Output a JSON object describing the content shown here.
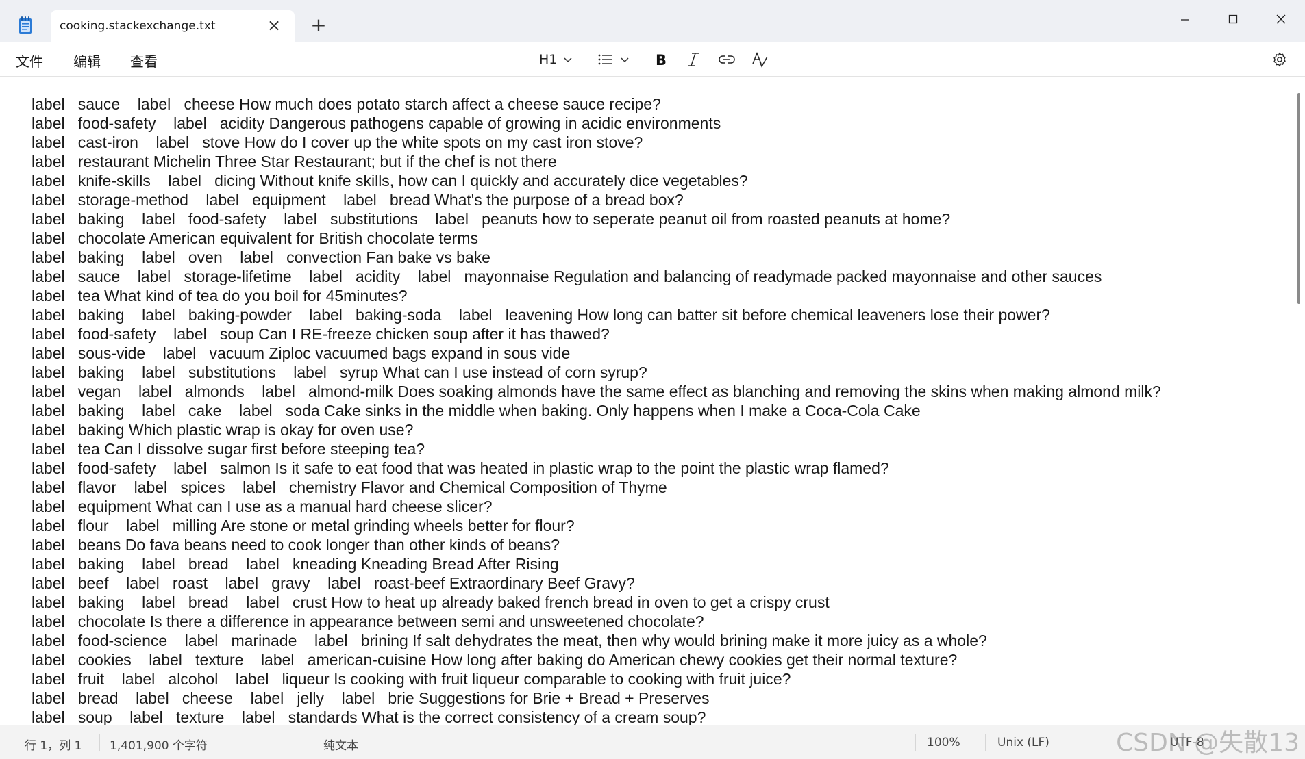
{
  "window": {
    "tab_title": "cooking.stackexchange.txt",
    "new_tab_symbol": "+",
    "close_tab_symbol": "×"
  },
  "menu": {
    "file": "文件",
    "edit": "编辑",
    "view": "查看"
  },
  "toolbar": {
    "heading": "H1"
  },
  "lines": [
    "label   sauce    label   cheese How much does potato starch affect a cheese sauce recipe?",
    "label   food-safety    label   acidity Dangerous pathogens capable of growing in acidic environments",
    "label   cast-iron    label   stove How do I cover up the white spots on my cast iron stove?",
    "label   restaurant Michelin Three Star Restaurant; but if the chef is not there",
    "label   knife-skills    label   dicing Without knife skills, how can I quickly and accurately dice vegetables?",
    "label   storage-method    label   equipment    label   bread What's the purpose of a bread box?",
    "label   baking    label   food-safety    label   substitutions    label   peanuts how to seperate peanut oil from roasted peanuts at home?",
    "label   chocolate American equivalent for British chocolate terms",
    "label   baking    label   oven    label   convection Fan bake vs bake",
    "label   sauce    label   storage-lifetime    label   acidity    label   mayonnaise Regulation and balancing of readymade packed mayonnaise and other sauces",
    "label   tea What kind of tea do you boil for 45minutes?",
    "label   baking    label   baking-powder    label   baking-soda    label   leavening How long can batter sit before chemical leaveners lose their power?",
    "label   food-safety    label   soup Can I RE-freeze chicken soup after it has thawed?",
    "label   sous-vide    label   vacuum Ziploc vacuumed bags expand in sous vide",
    "label   baking    label   substitutions    label   syrup What can I use instead of corn syrup?",
    "label   vegan    label   almonds    label   almond-milk Does soaking almonds have the same effect as blanching and removing the skins when making almond milk?",
    "label   baking    label   cake    label   soda Cake sinks in the middle when baking. Only happens when I make a Coca-Cola Cake",
    "label   baking Which plastic wrap is okay for oven use?",
    "label   tea Can I dissolve sugar first before steeping tea?",
    "label   food-safety    label   salmon Is it safe to eat food that was heated in plastic wrap to the point the plastic wrap flamed?",
    "label   flavor    label   spices    label   chemistry Flavor and Chemical Composition of Thyme",
    "label   equipment What can I use as a manual hard cheese slicer?",
    "label   flour    label   milling Are stone or metal grinding wheels better for flour?",
    "label   beans Do fava beans need to cook longer than other kinds of beans?",
    "label   baking    label   bread    label   kneading Kneading Bread After Rising",
    "label   beef    label   roast    label   gravy    label   roast-beef Extraordinary Beef Gravy?",
    "label   baking    label   bread    label   crust How to heat up already baked french bread in oven to get a crispy crust",
    "label   chocolate Is there a difference in appearance between semi and unsweetened chocolate?",
    "label   food-science    label   marinade    label   brining If salt dehydrates the meat, then why would brining make it more juicy as a whole?",
    "label   cookies    label   texture    label   american-cuisine How long after baking do American chewy cookies get their normal texture?",
    "label   fruit    label   alcohol    label   liqueur Is cooking with fruit liqueur comparable to cooking with fruit juice?",
    "label   bread    label   cheese    label   jelly    label   brie Suggestions for Brie + Bread + Preserves",
    "label   soup    label   texture    label   standards What is the correct consistency of a cream soup?"
  ],
  "status": {
    "position": "行 1，列 1",
    "char_count": "1,401,900 个字符",
    "format": "纯文本",
    "zoom": "100%",
    "line_ending": "Unix (LF)",
    "encoding": "UTF-8"
  },
  "watermark": "CSDN @失散13",
  "colors": {
    "titlebar_bg": "#eef0f4",
    "editor_bg": "#ffffff",
    "statusbar_bg": "#f3f3f3",
    "app_icon": "#2b7bd6"
  },
  "icons": {
    "app": "notepad-icon",
    "bullet_list": "bullet-list-icon",
    "bold": "bold-icon",
    "italic": "italic-icon",
    "link": "link-icon",
    "clear_formatting": "clear-formatting-icon",
    "settings": "gear-icon"
  }
}
